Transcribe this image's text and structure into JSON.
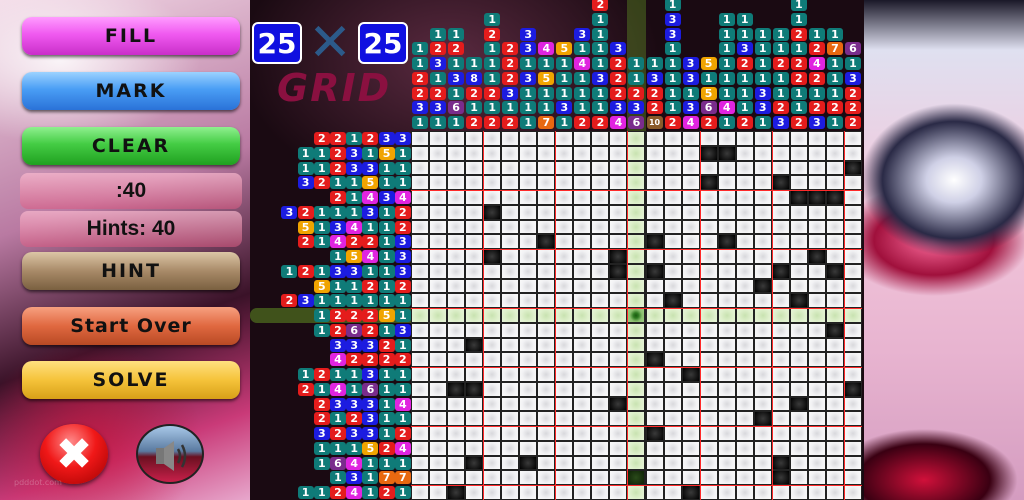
{
  "app": {
    "puzzle_size_left": "25",
    "puzzle_size_right": "25",
    "size_separator": "✕",
    "logo_word": "GRID"
  },
  "buttons": {
    "fill": "FILL",
    "mark": "MARK",
    "clear": "CLEAR",
    "hint": "HINT",
    "start_over": "Start Over",
    "solve": "SOLVE",
    "close_icon": "close-icon",
    "sound_icon": "speaker-icon"
  },
  "status": {
    "timer": ":40",
    "hints": "Hints: 40"
  },
  "colors": {
    "1": "#0f7b78",
    "2": "#e41c1c",
    "3": "#1c1ce0",
    "4": "#e024e0",
    "5": "#f0a400",
    "6": "#7a2c8c",
    "7": "#e86810",
    "8": "#1c1ce0",
    "10": "#8a5a2a"
  },
  "grid": {
    "rows": 25,
    "cols": 25,
    "highlight_row": 13,
    "highlight_col": 13,
    "cursor": [
      13,
      13
    ],
    "column_clues": [
      [
        1,
        1,
        2,
        2,
        3,
        1
      ],
      [
        1,
        2,
        3,
        1,
        2,
        3,
        1
      ],
      [
        1,
        2,
        1,
        3,
        1,
        6,
        1
      ],
      [
        1,
        8,
        2,
        1,
        2
      ],
      [
        1,
        2,
        1,
        1,
        1,
        2,
        1,
        2
      ],
      [
        2,
        2,
        2,
        3,
        1,
        2
      ],
      [
        3,
        3,
        1,
        3,
        1,
        1,
        1
      ],
      [
        4,
        1,
        5,
        1,
        1,
        7
      ],
      [
        5,
        1,
        1,
        1,
        3,
        1
      ],
      [
        3,
        1,
        4,
        1,
        1,
        1,
        2
      ],
      [
        2,
        1,
        1,
        1,
        1,
        3,
        1,
        1,
        2
      ],
      [
        3,
        2,
        2,
        2,
        3,
        4
      ],
      [
        1,
        1,
        2,
        3,
        6
      ],
      [
        1,
        3,
        2,
        2,
        10
      ],
      [
        1,
        3,
        3,
        1,
        1,
        1,
        1,
        1,
        2
      ],
      [
        3,
        3,
        1,
        3,
        4
      ],
      [
        5,
        1,
        5,
        6,
        2
      ],
      [
        1,
        1,
        1,
        1,
        1,
        1,
        4,
        1
      ],
      [
        1,
        1,
        3,
        2,
        1,
        1,
        1,
        2
      ],
      [
        1,
        1,
        1,
        1,
        3,
        3,
        1
      ],
      [
        1,
        1,
        2,
        1,
        1,
        2,
        3
      ],
      [
        1,
        1,
        2,
        1,
        2,
        2,
        1,
        1,
        2
      ],
      [
        1,
        2,
        4,
        2,
        1,
        2,
        3
      ],
      [
        1,
        7,
        1,
        1,
        1,
        2,
        1
      ],
      [
        6,
        1,
        3,
        2,
        2,
        2
      ]
    ],
    "row_clues": [
      [
        2,
        2,
        1,
        2,
        3,
        3
      ],
      [
        1,
        1,
        2,
        3,
        1,
        5,
        1
      ],
      [
        1,
        1,
        2,
        3,
        3,
        1,
        1
      ],
      [
        3,
        2,
        1,
        1,
        5,
        1,
        1
      ],
      [
        2,
        1,
        4,
        3,
        4
      ],
      [
        3,
        2,
        1,
        1,
        1,
        3,
        1,
        2
      ],
      [
        5,
        1,
        3,
        4,
        1,
        1,
        2
      ],
      [
        2,
        1,
        4,
        2,
        2,
        1,
        3
      ],
      [
        1,
        5,
        4,
        1,
        3
      ],
      [
        1,
        2,
        1,
        3,
        3,
        1,
        1,
        3
      ],
      [
        5,
        1,
        1,
        2,
        1,
        2
      ],
      [
        2,
        3,
        1,
        1,
        1,
        1,
        1,
        1
      ],
      [
        1,
        2,
        2,
        2,
        5,
        1
      ],
      [
        1,
        2,
        6,
        2,
        1,
        3
      ],
      [
        3,
        3,
        3,
        2,
        1
      ],
      [
        4,
        2,
        2,
        2,
        2
      ],
      [
        1,
        2,
        1,
        1,
        3,
        1,
        1
      ],
      [
        2,
        1,
        4,
        1,
        6,
        1,
        1
      ],
      [
        2,
        3,
        3,
        3,
        1,
        4
      ],
      [
        2,
        1,
        2,
        3,
        1,
        1
      ],
      [
        3,
        2,
        3,
        3,
        1,
        2
      ],
      [
        1,
        1,
        1,
        5,
        2,
        4
      ],
      [
        1,
        6,
        4,
        1,
        1,
        1
      ],
      [
        1,
        3,
        1,
        7,
        7
      ],
      [
        1,
        1,
        2,
        4,
        1,
        2,
        1
      ]
    ],
    "filled_cells": [
      [
        2,
        17
      ],
      [
        2,
        18
      ],
      [
        3,
        25
      ],
      [
        4,
        17
      ],
      [
        4,
        21
      ],
      [
        5,
        22
      ],
      [
        5,
        23
      ],
      [
        5,
        24
      ],
      [
        6,
        5
      ],
      [
        8,
        8
      ],
      [
        8,
        14
      ],
      [
        8,
        18
      ],
      [
        9,
        5
      ],
      [
        9,
        12
      ],
      [
        9,
        23
      ],
      [
        10,
        12
      ],
      [
        10,
        14
      ],
      [
        10,
        21
      ],
      [
        10,
        24
      ],
      [
        11,
        20
      ],
      [
        12,
        15
      ],
      [
        12,
        22
      ],
      [
        14,
        24
      ],
      [
        15,
        4
      ],
      [
        16,
        14
      ],
      [
        17,
        16
      ],
      [
        18,
        3
      ],
      [
        18,
        4
      ],
      [
        18,
        25
      ],
      [
        19,
        12
      ],
      [
        19,
        22
      ],
      [
        20,
        20
      ],
      [
        21,
        14
      ],
      [
        23,
        4
      ],
      [
        23,
        7
      ],
      [
        23,
        21
      ],
      [
        24,
        13
      ],
      [
        24,
        21
      ],
      [
        25,
        3
      ],
      [
        25,
        16
      ]
    ]
  }
}
